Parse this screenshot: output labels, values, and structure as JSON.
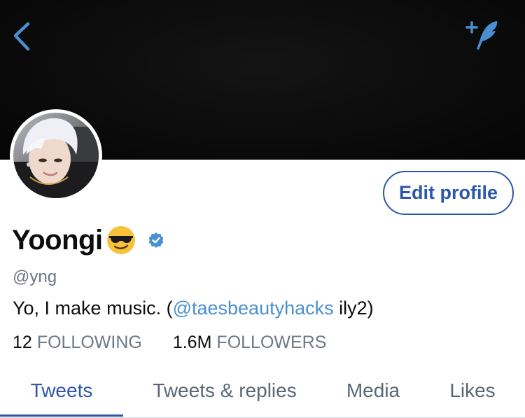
{
  "header": {
    "back_icon": "chevron-left-icon",
    "compose_icon": "compose-tweet-icon",
    "accent_color": "#4a90d0"
  },
  "profile": {
    "display_name": "Yoongi",
    "name_emoji": "😎",
    "verified_icon": "verified-badge-icon",
    "handle": "@yng",
    "bio": {
      "before": "Yo, I make music. (",
      "mention": "@taesbeautyhacks",
      "after": " ily2)"
    },
    "following_count": "12",
    "following_label": "FOLLOWING",
    "followers_count": "1.6M",
    "followers_label": "FOLLOWERS"
  },
  "actions": {
    "edit_profile": "Edit profile",
    "button_color": "#2d57a8"
  },
  "tabs": [
    {
      "label": "Tweets",
      "active": true
    },
    {
      "label": "Tweets & replies",
      "active": false
    },
    {
      "label": "Media",
      "active": false
    },
    {
      "label": "Likes",
      "active": false
    }
  ]
}
